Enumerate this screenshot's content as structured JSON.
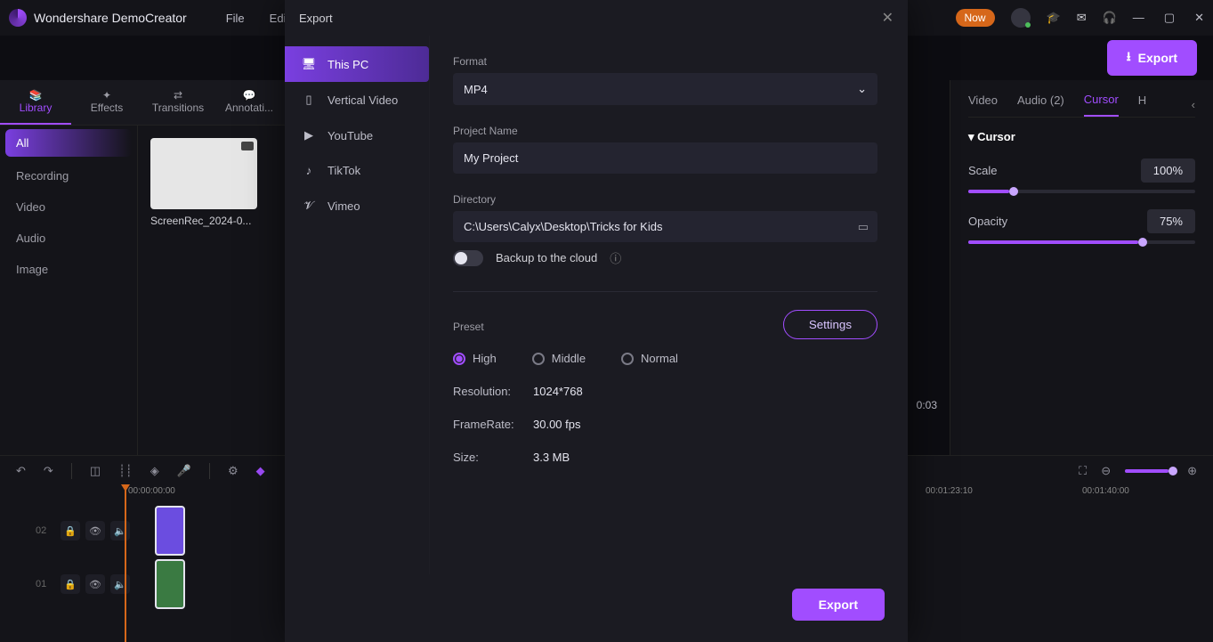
{
  "app": {
    "name": "Wondershare DemoCreator"
  },
  "menu": [
    "File",
    "Edit"
  ],
  "title_right": {
    "pill": "Now"
  },
  "top_toolbar": {
    "export_label": "Export"
  },
  "lib_tabs": [
    {
      "label": "Library",
      "active": true
    },
    {
      "label": "Effects",
      "active": false
    },
    {
      "label": "Transitions",
      "active": false
    },
    {
      "label": "Annotati...",
      "active": false
    }
  ],
  "lib_cats": [
    "All",
    "Recording",
    "Video",
    "Audio",
    "Image"
  ],
  "media": {
    "thumb_label": "ScreenRec_2024-0..."
  },
  "props_tabs": [
    "Video",
    "Audio (2)",
    "Cursor",
    "H"
  ],
  "props": {
    "section": "Cursor",
    "scale": {
      "label": "Scale",
      "value": "100%",
      "pct": 18
    },
    "opacity": {
      "label": "Opacity",
      "value": "75%",
      "pct": 75
    }
  },
  "timeline": {
    "t0": "00:00:00:00",
    "marks": [
      "00:01:23:10",
      "00:01:40:00"
    ],
    "preview_time": "0:03"
  },
  "modal": {
    "title": "Export",
    "sidebar": [
      {
        "label": "This PC",
        "icon": "pc",
        "active": true
      },
      {
        "label": "Vertical Video",
        "icon": "phone"
      },
      {
        "label": "YouTube",
        "icon": "yt"
      },
      {
        "label": "TikTok",
        "icon": "tiktok"
      },
      {
        "label": "Vimeo",
        "icon": "vimeo"
      }
    ],
    "format": {
      "label": "Format",
      "value": "MP4"
    },
    "project_name": {
      "label": "Project Name",
      "value": "My Project"
    },
    "directory": {
      "label": "Directory",
      "value": "C:\\Users\\Calyx\\Desktop\\Tricks for Kids"
    },
    "backup": {
      "label": "Backup to the cloud"
    },
    "preset": {
      "label": "Preset",
      "settings_label": "Settings"
    },
    "presets": [
      "High",
      "Middle",
      "Normal"
    ],
    "resolution": {
      "k": "Resolution:",
      "v": "1024*768"
    },
    "framerate": {
      "k": "FrameRate:",
      "v": "30.00 fps"
    },
    "size": {
      "k": "Size:",
      "v": "3.3 MB"
    },
    "export_btn": "Export"
  }
}
